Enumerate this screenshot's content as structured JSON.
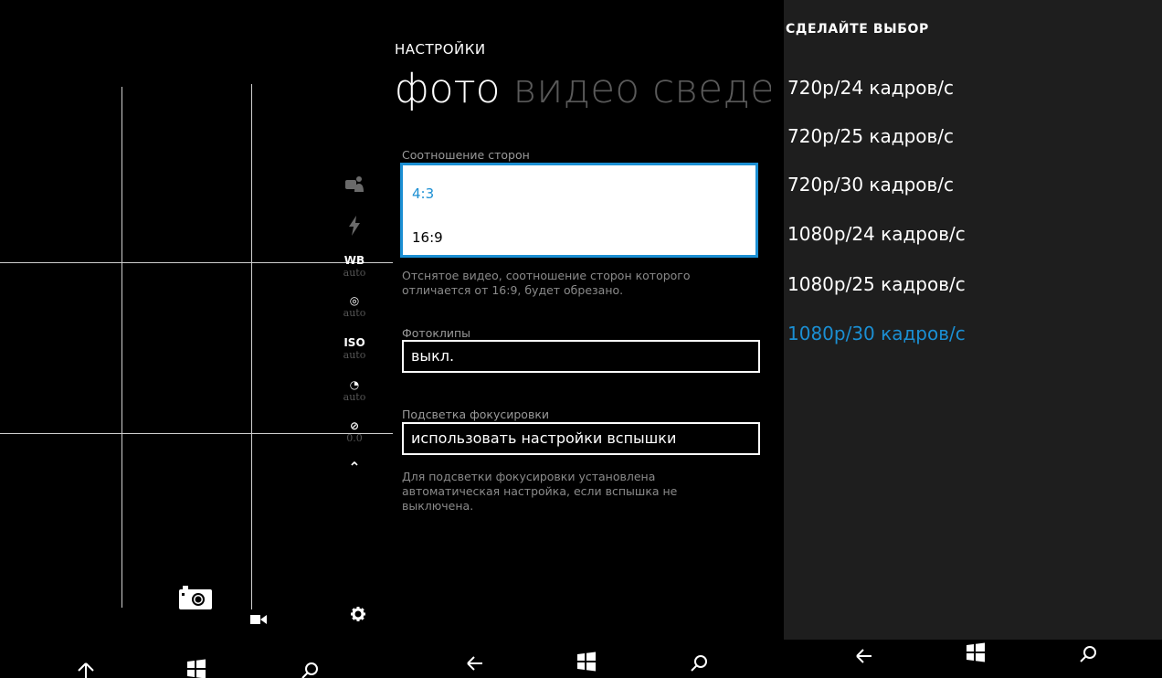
{
  "viewfinder": {
    "side_icons": [
      {
        "name": "lenses-icon"
      },
      {
        "name": "flash-icon"
      }
    ],
    "side_settings": [
      {
        "symbol": "WB",
        "value": "auto"
      },
      {
        "symbol": "◎",
        "value": "auto"
      },
      {
        "symbol": "ISO",
        "value": "auto"
      },
      {
        "symbol": "◔",
        "value": "auto"
      },
      {
        "symbol": "⊘",
        "value": "0.0"
      }
    ],
    "expand_symbol": "⌃"
  },
  "settings": {
    "title": "НАСТРОЙКИ",
    "tabs": [
      {
        "label": "фото",
        "active": true
      },
      {
        "label": "видео",
        "active": false
      },
      {
        "label": "сведения",
        "active": false
      }
    ],
    "aspect_ratio": {
      "label": "Соотношение сторон",
      "options": [
        "4:3",
        "16:9"
      ],
      "selected": "4:3",
      "note": "Отснятое видео, соотношение сторон которого отличается от 16:9, будет обрезано."
    },
    "photo_clips": {
      "label": "Фотоклипы",
      "value": "выкл."
    },
    "focus_assist": {
      "label": "Подсветка фокусировки",
      "value": "использовать настройки вспышки",
      "note": "Для подсветки фокусировки установлена автоматическая настройка, если вспышка не выключена."
    }
  },
  "picker": {
    "title": "СДЕЛАЙТЕ ВЫБОР",
    "items": [
      "720p/24 кадров/с",
      "720p/25 кадров/с",
      "720p/30 кадров/с",
      "1080p/24 кадров/с",
      "1080p/25 кадров/с",
      "1080p/30 кадров/с"
    ],
    "selected_index": 5
  },
  "colors": {
    "accent": "#1b8fd3",
    "picker_bg": "#1e1e1e"
  }
}
